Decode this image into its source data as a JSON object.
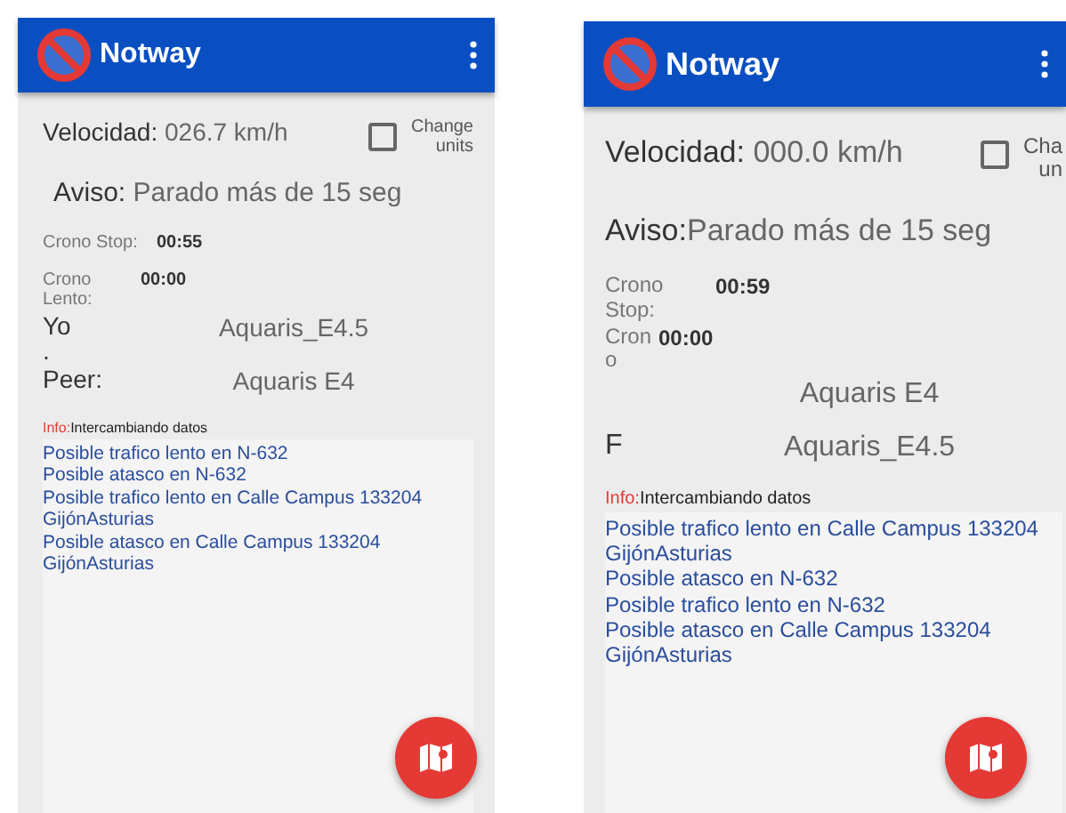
{
  "phones": [
    {
      "app_bar": {
        "title": "Notway"
      },
      "speed": {
        "label": "Velocidad:",
        "value": "026.7 km/h"
      },
      "change_units": {
        "checked": false,
        "label_lines": [
          "Change",
          "units"
        ]
      },
      "aviso": {
        "label": "Aviso:",
        "value": "Parado más de 15 seg"
      },
      "rows": [
        {
          "kind": "timer",
          "label_lines": [
            "Crono Stop:"
          ],
          "value": "00:55"
        },
        {
          "kind": "timer",
          "label_lines": [
            "Crono",
            "Lento:"
          ],
          "value": "00:00"
        },
        {
          "kind": "device",
          "label_lines": [
            "Yo",
            "."
          ],
          "value": "Aquaris_E4.5"
        },
        {
          "kind": "device",
          "label_lines": [
            "Peer:"
          ],
          "value": "Aquaris E4"
        }
      ],
      "info": {
        "label": "Info:",
        "value": "Intercambiando datos"
      },
      "messages": [
        "Posible trafico lento en N-632",
        "Posible atasco en N-632",
        "Posible trafico lento en Calle Campus 133204 GijónAsturias",
        "Posible atasco en Calle Campus 133204 GijónAsturias"
      ]
    },
    {
      "app_bar": {
        "title": "Notway"
      },
      "speed": {
        "label": "Velocidad:",
        "value": "000.0 km/h"
      },
      "change_units": {
        "checked": false,
        "label_lines": [
          "Cha",
          "un"
        ]
      },
      "aviso": {
        "label": "Aviso:",
        "value": "Parado más de 15 seg"
      },
      "rows": [
        {
          "kind": "timer",
          "label_lines": [
            "Crono",
            "Stop:"
          ],
          "value": "00:59"
        },
        {
          "kind": "timer",
          "label_lines": [
            "Cron",
            "o"
          ],
          "value": "00:00"
        },
        {
          "kind": "device",
          "value": "Aquaris E4"
        },
        {
          "kind": "device",
          "label_lines": [
            "F"
          ],
          "value": "Aquaris_E4.5"
        }
      ],
      "info": {
        "label": "Info:",
        "value": "Intercambiando datos"
      },
      "messages": [
        "Posible trafico lento en Calle Campus 133204 GijónAsturias",
        "Posible atasco en N-632",
        "Posible trafico lento en N-632",
        "Posible atasco en Calle Campus 133204 GijónAsturias"
      ]
    }
  ]
}
